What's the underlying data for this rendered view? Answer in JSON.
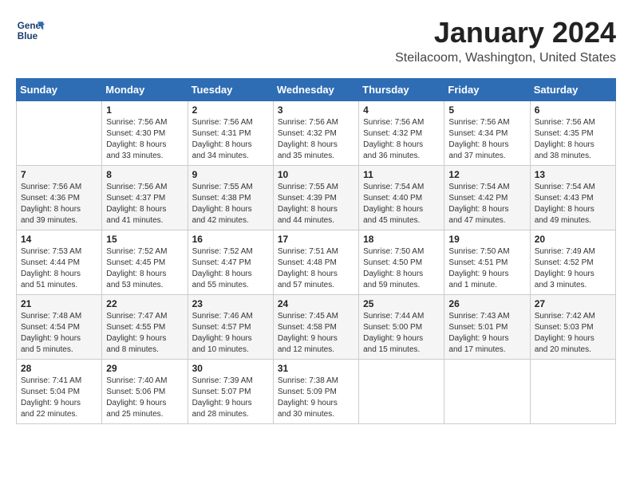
{
  "logo": {
    "line1": "General",
    "line2": "Blue"
  },
  "title": "January 2024",
  "location": "Steilacoom, Washington, United States",
  "weekdays": [
    "Sunday",
    "Monday",
    "Tuesday",
    "Wednesday",
    "Thursday",
    "Friday",
    "Saturday"
  ],
  "weeks": [
    [
      {
        "day": "",
        "info": ""
      },
      {
        "day": "1",
        "info": "Sunrise: 7:56 AM\nSunset: 4:30 PM\nDaylight: 8 hours\nand 33 minutes."
      },
      {
        "day": "2",
        "info": "Sunrise: 7:56 AM\nSunset: 4:31 PM\nDaylight: 8 hours\nand 34 minutes."
      },
      {
        "day": "3",
        "info": "Sunrise: 7:56 AM\nSunset: 4:32 PM\nDaylight: 8 hours\nand 35 minutes."
      },
      {
        "day": "4",
        "info": "Sunrise: 7:56 AM\nSunset: 4:32 PM\nDaylight: 8 hours\nand 36 minutes."
      },
      {
        "day": "5",
        "info": "Sunrise: 7:56 AM\nSunset: 4:34 PM\nDaylight: 8 hours\nand 37 minutes."
      },
      {
        "day": "6",
        "info": "Sunrise: 7:56 AM\nSunset: 4:35 PM\nDaylight: 8 hours\nand 38 minutes."
      }
    ],
    [
      {
        "day": "7",
        "info": "Sunrise: 7:56 AM\nSunset: 4:36 PM\nDaylight: 8 hours\nand 39 minutes."
      },
      {
        "day": "8",
        "info": "Sunrise: 7:56 AM\nSunset: 4:37 PM\nDaylight: 8 hours\nand 41 minutes."
      },
      {
        "day": "9",
        "info": "Sunrise: 7:55 AM\nSunset: 4:38 PM\nDaylight: 8 hours\nand 42 minutes."
      },
      {
        "day": "10",
        "info": "Sunrise: 7:55 AM\nSunset: 4:39 PM\nDaylight: 8 hours\nand 44 minutes."
      },
      {
        "day": "11",
        "info": "Sunrise: 7:54 AM\nSunset: 4:40 PM\nDaylight: 8 hours\nand 45 minutes."
      },
      {
        "day": "12",
        "info": "Sunrise: 7:54 AM\nSunset: 4:42 PM\nDaylight: 8 hours\nand 47 minutes."
      },
      {
        "day": "13",
        "info": "Sunrise: 7:54 AM\nSunset: 4:43 PM\nDaylight: 8 hours\nand 49 minutes."
      }
    ],
    [
      {
        "day": "14",
        "info": "Sunrise: 7:53 AM\nSunset: 4:44 PM\nDaylight: 8 hours\nand 51 minutes."
      },
      {
        "day": "15",
        "info": "Sunrise: 7:52 AM\nSunset: 4:45 PM\nDaylight: 8 hours\nand 53 minutes."
      },
      {
        "day": "16",
        "info": "Sunrise: 7:52 AM\nSunset: 4:47 PM\nDaylight: 8 hours\nand 55 minutes."
      },
      {
        "day": "17",
        "info": "Sunrise: 7:51 AM\nSunset: 4:48 PM\nDaylight: 8 hours\nand 57 minutes."
      },
      {
        "day": "18",
        "info": "Sunrise: 7:50 AM\nSunset: 4:50 PM\nDaylight: 8 hours\nand 59 minutes."
      },
      {
        "day": "19",
        "info": "Sunrise: 7:50 AM\nSunset: 4:51 PM\nDaylight: 9 hours\nand 1 minute."
      },
      {
        "day": "20",
        "info": "Sunrise: 7:49 AM\nSunset: 4:52 PM\nDaylight: 9 hours\nand 3 minutes."
      }
    ],
    [
      {
        "day": "21",
        "info": "Sunrise: 7:48 AM\nSunset: 4:54 PM\nDaylight: 9 hours\nand 5 minutes."
      },
      {
        "day": "22",
        "info": "Sunrise: 7:47 AM\nSunset: 4:55 PM\nDaylight: 9 hours\nand 8 minutes."
      },
      {
        "day": "23",
        "info": "Sunrise: 7:46 AM\nSunset: 4:57 PM\nDaylight: 9 hours\nand 10 minutes."
      },
      {
        "day": "24",
        "info": "Sunrise: 7:45 AM\nSunset: 4:58 PM\nDaylight: 9 hours\nand 12 minutes."
      },
      {
        "day": "25",
        "info": "Sunrise: 7:44 AM\nSunset: 5:00 PM\nDaylight: 9 hours\nand 15 minutes."
      },
      {
        "day": "26",
        "info": "Sunrise: 7:43 AM\nSunset: 5:01 PM\nDaylight: 9 hours\nand 17 minutes."
      },
      {
        "day": "27",
        "info": "Sunrise: 7:42 AM\nSunset: 5:03 PM\nDaylight: 9 hours\nand 20 minutes."
      }
    ],
    [
      {
        "day": "28",
        "info": "Sunrise: 7:41 AM\nSunset: 5:04 PM\nDaylight: 9 hours\nand 22 minutes."
      },
      {
        "day": "29",
        "info": "Sunrise: 7:40 AM\nSunset: 5:06 PM\nDaylight: 9 hours\nand 25 minutes."
      },
      {
        "day": "30",
        "info": "Sunrise: 7:39 AM\nSunset: 5:07 PM\nDaylight: 9 hours\nand 28 minutes."
      },
      {
        "day": "31",
        "info": "Sunrise: 7:38 AM\nSunset: 5:09 PM\nDaylight: 9 hours\nand 30 minutes."
      },
      {
        "day": "",
        "info": ""
      },
      {
        "day": "",
        "info": ""
      },
      {
        "day": "",
        "info": ""
      }
    ]
  ]
}
